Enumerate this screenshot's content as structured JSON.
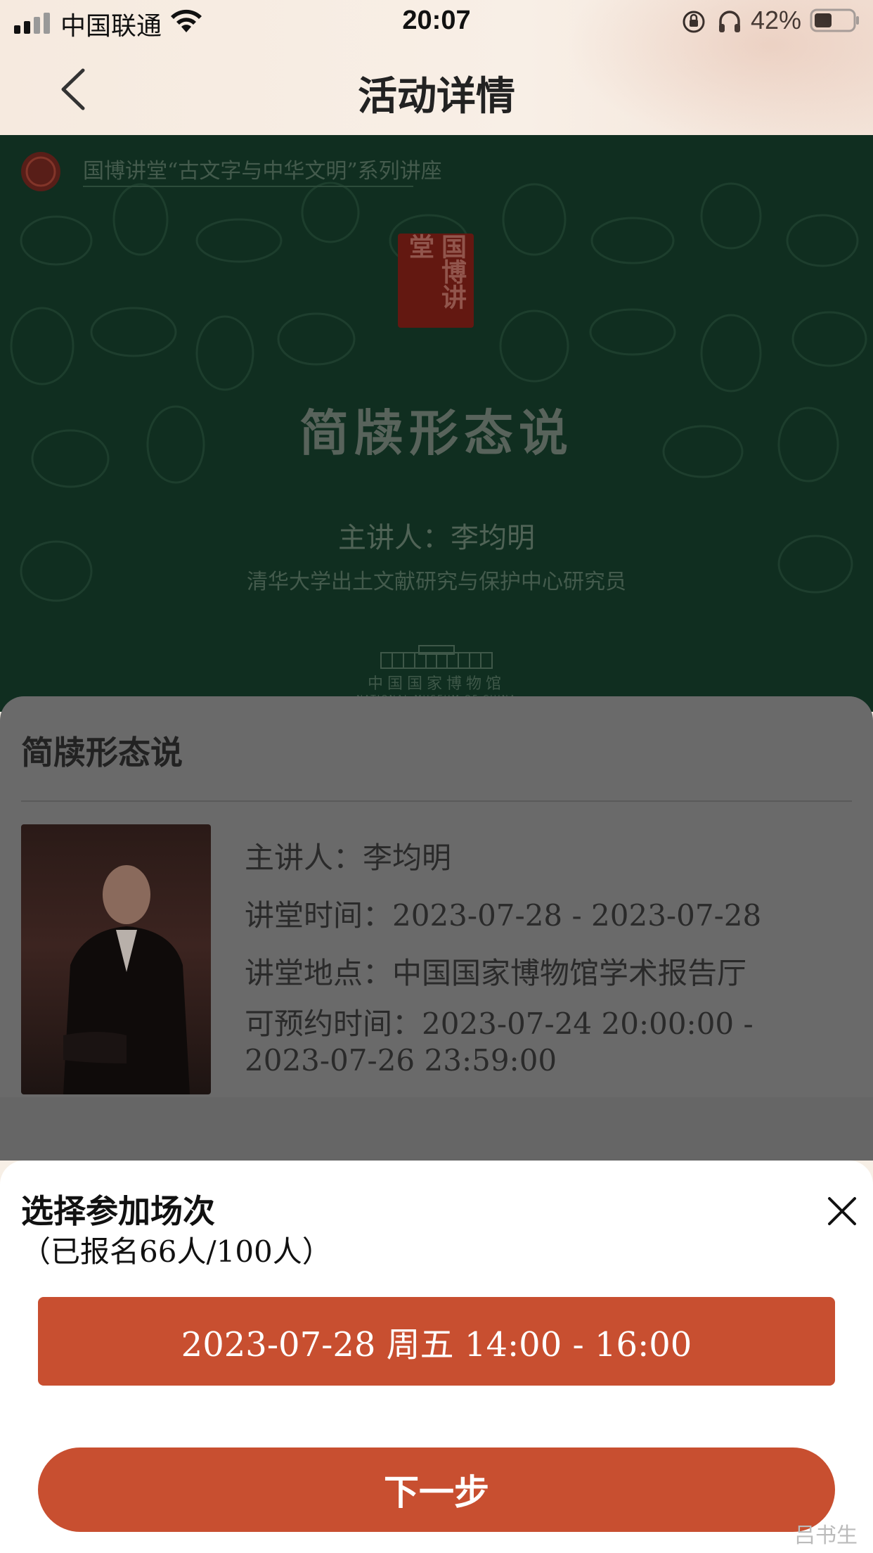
{
  "status_bar": {
    "carrier": "中国联通",
    "time": "20:07",
    "battery": "42%"
  },
  "nav": {
    "title": "活动详情"
  },
  "poster": {
    "series_title": "国博讲堂“古文字与中华文明”系列讲座",
    "seal_text": "国博讲堂",
    "lecture_title": "简牍形态说",
    "speaker": "主讲人：李均明",
    "affiliation": "清华大学出土文献研究与保护中心研究员",
    "museum_cn": "中国国家博物馆",
    "museum_en": "NATIONAL MUSEUM OF CHINA"
  },
  "details": {
    "title": "简牍形态说",
    "speaker": "主讲人：李均明",
    "time": "讲堂时间：2023-07-28 - 2023-07-28",
    "place": "讲堂地点：中国国家博物馆学术报告厅",
    "booking": "可预约时间：2023-07-24 20:00:00 - 2023-07-26 23:59:00"
  },
  "sheet": {
    "title": "选择参加场次",
    "count": "（已报名66人/100人）",
    "session": "2023-07-28 周五 14:00 - 16:00",
    "next": "下一步"
  },
  "watermark": "吕书生",
  "colors": {
    "accent": "#c84f30",
    "poster_green": "#17402d",
    "overlay_gray": "#6a6a6a"
  }
}
